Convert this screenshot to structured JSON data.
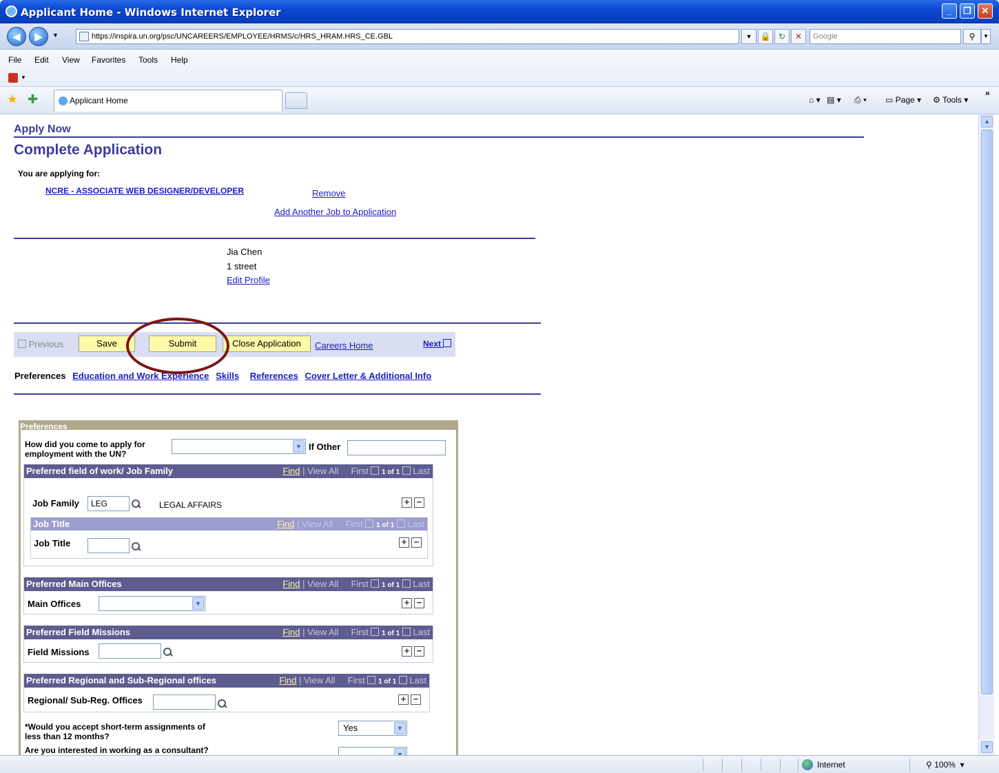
{
  "window": {
    "title": "Applicant Home - Windows Internet Explorer"
  },
  "address": {
    "url": "https://inspira.un.org/psc/UNCAREERS/EMPLOYEE/HRMS/c/HRS_HRAM.HRS_CE.GBL",
    "search_placeholder": "Google"
  },
  "menu": [
    "File",
    "Edit",
    "View",
    "Favorites",
    "Tools",
    "Help"
  ],
  "tab": {
    "label": "Applicant Home"
  },
  "toolbar_right": {
    "page": "Page",
    "tools": "Tools"
  },
  "page": {
    "breadcrumb": "Apply Now",
    "title": "Complete Application",
    "applying_for_label": "You are applying for:",
    "job": "NCRE - ASSOCIATE WEB DESIGNER/DEVELOPER",
    "remove": "Remove",
    "add_another": "Add Another Job to Application",
    "profile": {
      "name": "Jia Chen",
      "address": "1 street",
      "edit": "Edit Profile"
    },
    "buttons": {
      "previous": "Previous",
      "save": "Save",
      "submit": "Submit",
      "close": "Close Application",
      "careers_home": "Careers Home",
      "next": "Next"
    },
    "nav_tabs": {
      "current": "Preferences",
      "links": [
        "Education and Work Experience",
        "Skills",
        "References",
        "Cover Letter & Additional Info"
      ]
    }
  },
  "prefs": {
    "title": "Preferences",
    "how_label_1": "How did you come to apply for",
    "how_label_2": "employment with the UN?",
    "if_other": "If Other",
    "grid_nav": {
      "find": "Find",
      "view_all": "View All",
      "first": "First",
      "count": "1 of 1",
      "last": "Last",
      "sep": "|"
    },
    "job_family": {
      "header": "Preferred field of work/ Job Family",
      "label": "Job Family",
      "value": "LEG",
      "desc": "LEGAL AFFAIRS"
    },
    "job_title": {
      "header": "Job Title",
      "label": "Job Title",
      "value": ""
    },
    "main_offices": {
      "header": "Preferred Main Offices",
      "label": "Main Offices"
    },
    "field_missions": {
      "header": "Preferred Field Missions",
      "label": "Field Missions"
    },
    "regional": {
      "header": "Preferred Regional and Sub-Regional offices",
      "label": "Regional/ Sub-Reg. Offices"
    },
    "short_term": {
      "label_1": "*Would you accept short-term assignments of",
      "label_2": "less than 12 months?",
      "value": "Yes"
    },
    "consultant": {
      "label": "Are you interested in working as a consultant?"
    }
  },
  "status": {
    "zone": "Internet",
    "zoom": "100%"
  }
}
